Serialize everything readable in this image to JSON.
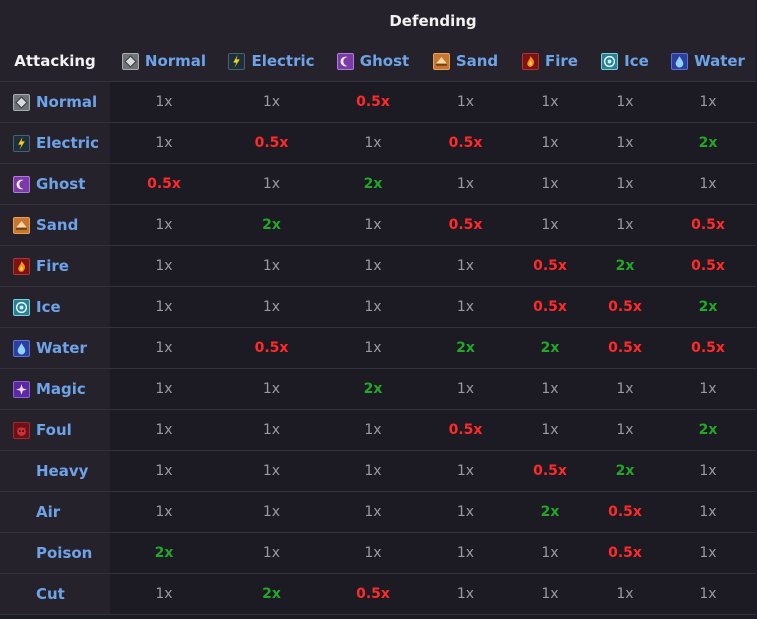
{
  "header": {
    "defending_label": "Defending",
    "attacking_label": "Attacking"
  },
  "columns": [
    {
      "label": "Normal",
      "icon": "normal-type-icon"
    },
    {
      "label": "Electric",
      "icon": "electric-type-icon"
    },
    {
      "label": "Ghost",
      "icon": "ghost-type-icon"
    },
    {
      "label": "Sand",
      "icon": "sand-type-icon"
    },
    {
      "label": "Fire",
      "icon": "fire-type-icon"
    },
    {
      "label": "Ice",
      "icon": "ice-type-icon"
    },
    {
      "label": "Water",
      "icon": "water-type-icon"
    }
  ],
  "rows": [
    {
      "label": "Normal",
      "icon": "normal-type-icon",
      "values": [
        "1x",
        "1x",
        "0.5x",
        "1x",
        "1x",
        "1x",
        "1x"
      ]
    },
    {
      "label": "Electric",
      "icon": "electric-type-icon",
      "values": [
        "1x",
        "0.5x",
        "1x",
        "0.5x",
        "1x",
        "1x",
        "2x"
      ]
    },
    {
      "label": "Ghost",
      "icon": "ghost-type-icon",
      "values": [
        "0.5x",
        "1x",
        "2x",
        "1x",
        "1x",
        "1x",
        "1x"
      ]
    },
    {
      "label": "Sand",
      "icon": "sand-type-icon",
      "values": [
        "1x",
        "2x",
        "1x",
        "0.5x",
        "1x",
        "1x",
        "0.5x"
      ]
    },
    {
      "label": "Fire",
      "icon": "fire-type-icon",
      "values": [
        "1x",
        "1x",
        "1x",
        "1x",
        "0.5x",
        "2x",
        "0.5x"
      ]
    },
    {
      "label": "Ice",
      "icon": "ice-type-icon",
      "values": [
        "1x",
        "1x",
        "1x",
        "1x",
        "0.5x",
        "0.5x",
        "2x"
      ]
    },
    {
      "label": "Water",
      "icon": "water-type-icon",
      "values": [
        "1x",
        "0.5x",
        "1x",
        "2x",
        "2x",
        "0.5x",
        "0.5x"
      ]
    },
    {
      "label": "Magic",
      "icon": "magic-type-icon",
      "values": [
        "1x",
        "1x",
        "2x",
        "1x",
        "1x",
        "1x",
        "1x"
      ]
    },
    {
      "label": "Foul",
      "icon": "foul-type-icon",
      "values": [
        "1x",
        "1x",
        "1x",
        "0.5x",
        "1x",
        "1x",
        "2x"
      ]
    },
    {
      "label": "Heavy",
      "icon": null,
      "values": [
        "1x",
        "1x",
        "1x",
        "1x",
        "0.5x",
        "2x",
        "1x"
      ]
    },
    {
      "label": "Air",
      "icon": null,
      "values": [
        "1x",
        "1x",
        "1x",
        "1x",
        "2x",
        "0.5x",
        "1x"
      ]
    },
    {
      "label": "Poison",
      "icon": null,
      "values": [
        "2x",
        "1x",
        "1x",
        "1x",
        "1x",
        "0.5x",
        "1x"
      ]
    },
    {
      "label": "Cut",
      "icon": null,
      "values": [
        "1x",
        "2x",
        "0.5x",
        "1x",
        "1x",
        "1x",
        "1x"
      ]
    }
  ],
  "colors": {
    "neutral": "#9a9aa0",
    "resisted": "#ff2a2a",
    "super_effective": "#22a827",
    "type_label": "#6fa3e8",
    "header_text": "#f2f2f2"
  }
}
